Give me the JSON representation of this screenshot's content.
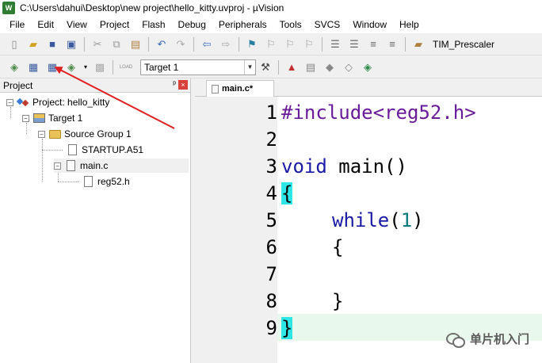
{
  "window": {
    "title": "C:\\Users\\dahui\\Desktop\\new project\\hello_kitty.uvproj - µVision",
    "app_icon": "uv-logo-icon"
  },
  "menu": [
    "File",
    "Edit",
    "View",
    "Project",
    "Flash",
    "Debug",
    "Peripherals",
    "Tools",
    "SVCS",
    "Window",
    "Help"
  ],
  "toolbar1": {
    "prescaler_label": "TIM_Prescaler"
  },
  "toolbar2": {
    "target": "Target 1",
    "load_label": "LOAD"
  },
  "project_panel": {
    "title": "Project",
    "pin": "ᵖ",
    "close": "×",
    "tree": {
      "project": "Project: hello_kitty",
      "target": "Target 1",
      "group": "Source Group 1",
      "startup": "STARTUP.A51",
      "main": "main.c",
      "header": "reg52.h"
    }
  },
  "editor": {
    "tab": "main.c*",
    "lines": [
      {
        "num": "1",
        "text": "#include<reg52.h>"
      },
      {
        "num": "2",
        "text": ""
      },
      {
        "num": "3",
        "kw": "void",
        "rest": " main()"
      },
      {
        "num": "4",
        "text": "{"
      },
      {
        "num": "5",
        "kw": "while",
        "paren_open": "(",
        "num_val": "1",
        "paren_close": ")"
      },
      {
        "num": "6",
        "text": "{"
      },
      {
        "num": "7",
        "text": ""
      },
      {
        "num": "8",
        "text": "}"
      },
      {
        "num": "9",
        "text": "}"
      }
    ]
  },
  "watermark": "单片机入门",
  "colors": {
    "accent_arrow": "#e02020",
    "brace_highlight": "#2ee6e6",
    "current_line": "#e8f8ec"
  }
}
